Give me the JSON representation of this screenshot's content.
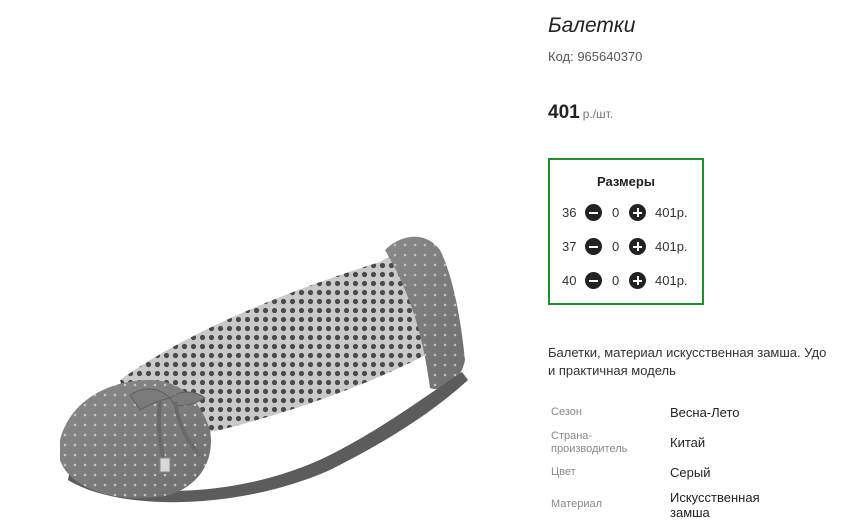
{
  "product": {
    "title": "Балетки",
    "code": "Код: 965640370",
    "price_value": "401",
    "price_unit": "р./шт."
  },
  "sizes": {
    "title": "Размеры",
    "rows": [
      {
        "size": "36",
        "qty": "0",
        "price": "401р."
      },
      {
        "size": "37",
        "qty": "0",
        "price": "401р."
      },
      {
        "size": "40",
        "qty": "0",
        "price": "401р."
      }
    ],
    "border_color": "#1e8f2a"
  },
  "description": {
    "line1": "Балетки, материал искусственная замша. Удо",
    "line2": "и практичная модель"
  },
  "attributes": {
    "season_label": "Сезон",
    "season_value": "Весна-Лето",
    "country_label_1": "Страна-",
    "country_label_2": "производитель",
    "country_value": "Китай",
    "color_label": "Цвет",
    "color_value": "Серый",
    "material_label": "Материал",
    "material_value_1": "Искусственная",
    "material_value_2": "замша"
  }
}
